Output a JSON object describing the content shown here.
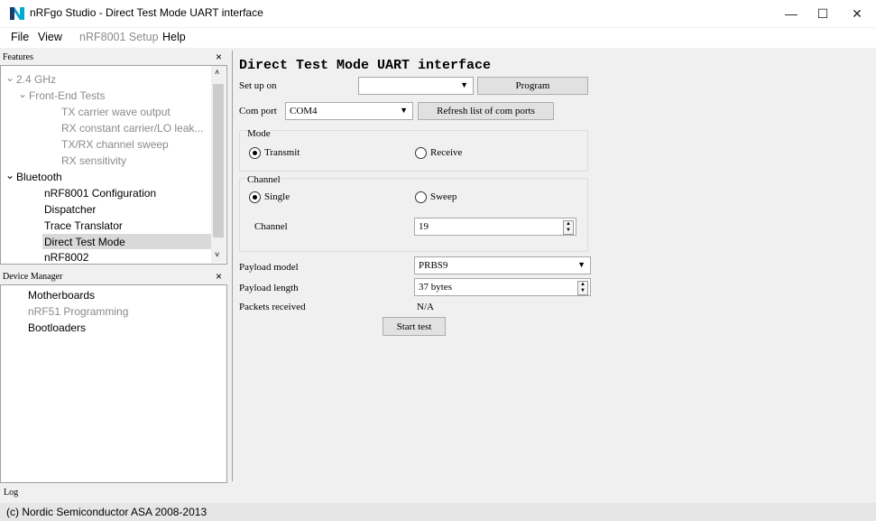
{
  "window": {
    "title": "nRFgo Studio  - Direct Test Mode UART interface",
    "minimize": "—",
    "maximize": "☐",
    "close": "✕"
  },
  "menu": [
    "File",
    "View",
    "nRF8001 Setup",
    "Help"
  ],
  "features_panel": {
    "title": "Features",
    "close": "×",
    "items": [
      {
        "label": "2.4 GHz",
        "state": "dim"
      },
      {
        "label": "Front-End Tests",
        "state": "dim"
      },
      {
        "label": "TX carrier wave output",
        "state": "dim"
      },
      {
        "label": "RX constant carrier/LO leak...",
        "state": "dim"
      },
      {
        "label": "TX/RX channel sweep",
        "state": "dim"
      },
      {
        "label": "RX sensitivity",
        "state": "dim"
      },
      {
        "label": "Bluetooth",
        "state": "normal"
      },
      {
        "label": "nRF8001 Configuration",
        "state": "normal"
      },
      {
        "label": "Dispatcher",
        "state": "normal"
      },
      {
        "label": "Trace Translator",
        "state": "normal"
      },
      {
        "label": "Direct Test Mode",
        "state": "selected"
      },
      {
        "label": "nRF8002",
        "state": "normal"
      }
    ]
  },
  "device_manager": {
    "title": "Device Manager",
    "close": "×",
    "items": [
      {
        "label": "Motherboards",
        "state": "normal"
      },
      {
        "label": "nRF51 Programming",
        "state": "dim"
      },
      {
        "label": "Bootloaders",
        "state": "normal"
      }
    ]
  },
  "main": {
    "heading": "Direct Test Mode UART interface",
    "setup_label": "Set up on",
    "setup_value": "",
    "program_button": "Program",
    "com_port_label": "Com port",
    "com_port_value": "COM4",
    "refresh_button": "Refresh list of com ports",
    "mode_group": "Mode",
    "transmit": "Transmit",
    "receive": "Receive",
    "channel_group": "Channel",
    "single": "Single",
    "sweep": "Sweep",
    "channel_label": "Channel",
    "channel_value": "19",
    "payload_model_label": "Payload model",
    "payload_model_value": "PRBS9",
    "payload_length_label": "Payload length",
    "payload_length_value": "37 bytes",
    "packets_label": "Packets received",
    "packets_value": "N/A",
    "start_button": "Start test"
  },
  "log": {
    "title": "Log"
  },
  "status": {
    "text": "(c) Nordic Semiconductor ASA 2008-2013"
  },
  "colors": {
    "selection": "#d9d9d9",
    "app_icon_a": "#00a9ce",
    "app_icon_b": "#1b3c6b"
  }
}
